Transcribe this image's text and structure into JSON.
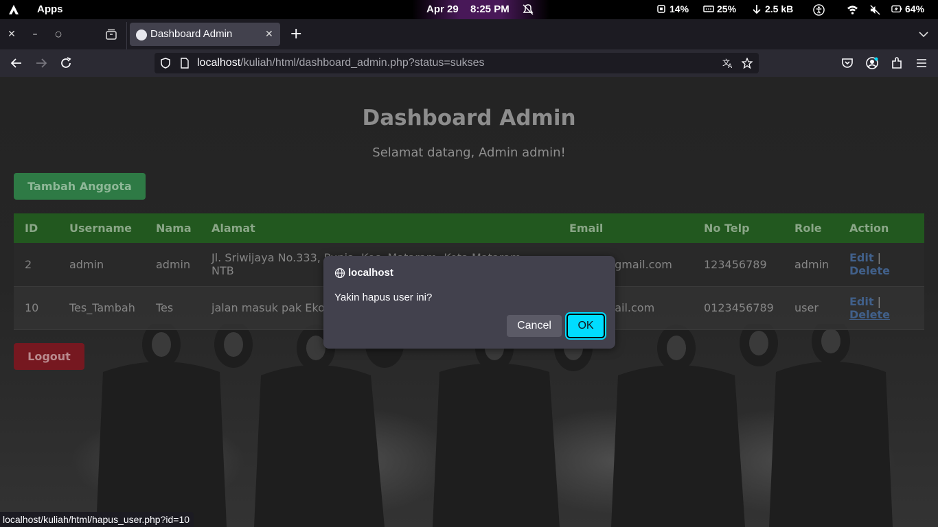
{
  "os_bar": {
    "apps_label": "Apps",
    "date": "Apr 29",
    "time": "8:25 PM",
    "cpu": "14%",
    "memory": "25%",
    "network": "2.5 kB",
    "battery": "64%"
  },
  "browser": {
    "tab_title": "Dashboard Admin",
    "url_host": "localhost",
    "url_path": "/kuliah/html/dashboard_admin.php?status=sukses",
    "status_bar_url": "localhost/kuliah/html/hapus_user.php?id=10"
  },
  "page": {
    "heading": "Dashboard Admin",
    "welcome": "Selamat datang, Admin admin!",
    "add_button": "Tambah Anggota",
    "logout_button": "Logout",
    "table": {
      "headers": [
        "ID",
        "Username",
        "Nama",
        "Alamat",
        "Email",
        "No Telp",
        "Role",
        "Action"
      ],
      "rows": [
        {
          "id": "2",
          "username": "admin",
          "nama": "admin",
          "alamat": "Jl. Sriwijaya No.333, Punia, Kec. Mataram, Kota Mataram, NTB",
          "email": "admin@gmail.com",
          "telp": "123456789",
          "role": "admin",
          "edit": "Edit",
          "delete": "Delete"
        },
        {
          "id": "10",
          "username": "Tes_Tambah",
          "nama": "Tes",
          "alamat": "jalan masuk pak Eko",
          "email": "tes@gmail.com",
          "telp": "0123456789",
          "role": "user",
          "edit": "Edit",
          "delete": "Delete"
        }
      ],
      "separator": "|"
    }
  },
  "dialog": {
    "title": "localhost",
    "message": "Yakin hapus user ini?",
    "cancel_label": "Cancel",
    "ok_label": "OK"
  },
  "colors": {
    "accent_ok": "#00ddff",
    "add_green": "#2e7a45",
    "logout_red": "#761820",
    "table_header": "#22581f"
  }
}
